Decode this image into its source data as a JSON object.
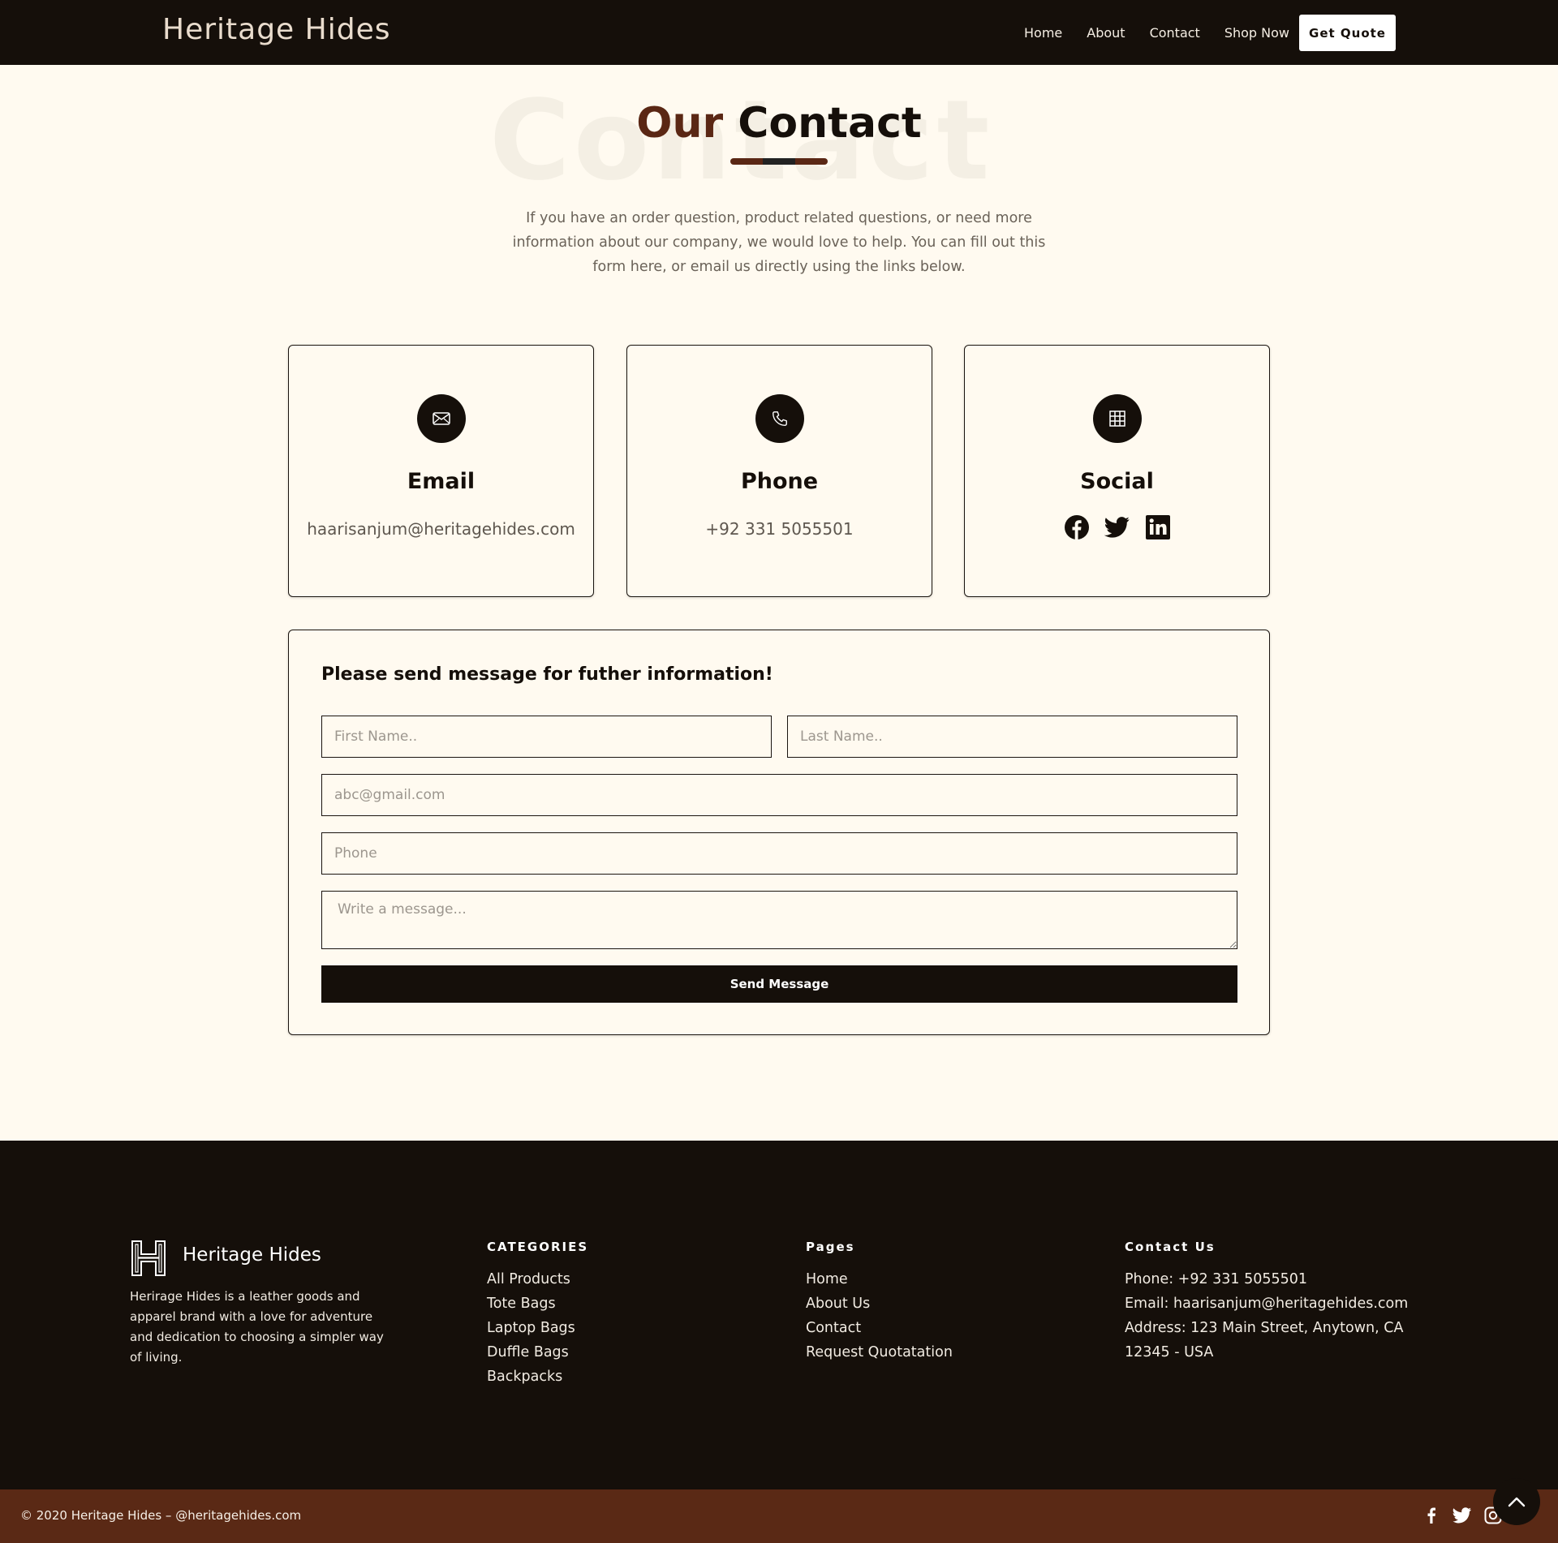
{
  "nav": {
    "brand": "Heritage Hides",
    "links": [
      "Home",
      "About",
      "Contact",
      "Shop Now"
    ],
    "quote_button": "Get Quote"
  },
  "hero": {
    "ghost_text": "Contact",
    "title_part1": "Our",
    "title_part2": "Contact",
    "intro": "If you have an order question, product related questions, or need more information about our company, we would love to help. You can fill out this form here, or email us directly using the links below."
  },
  "cards": {
    "email": {
      "icon": "envelope-icon",
      "title": "Email",
      "value": "haarisanjum@heritagehides.com"
    },
    "phone": {
      "icon": "phone-icon",
      "title": "Phone",
      "value": "+92 331 5055501"
    },
    "social": {
      "icon": "grid-icon",
      "title": "Social",
      "icons": [
        "facebook-icon",
        "twitter-icon",
        "linkedin-icon"
      ]
    }
  },
  "form": {
    "title": "Please send message for futher information!",
    "first_name_placeholder": "First Name..",
    "last_name_placeholder": "Last Name..",
    "email_placeholder": "abc@gmail.com",
    "phone_placeholder": "Phone",
    "message_placeholder": "Write a message...",
    "send_button": "Send Message"
  },
  "footer": {
    "brand": "Heritage Hides",
    "about": "Herirage Hides is a leather goods and apparel brand with a love for adventure and dedication to choosing a simpler way of living.",
    "categories": {
      "heading": "CATEGORIES",
      "items": [
        "All Products",
        "Tote Bags",
        "Laptop Bags",
        "Duffle Bags",
        "Backpacks"
      ]
    },
    "pages": {
      "heading": "Pages",
      "items": [
        "Home",
        "About Us",
        "Contact",
        "Request Quotatation"
      ]
    },
    "contact": {
      "heading": "Contact Us",
      "items": [
        "Phone: +92 331 5055501",
        "Email: haarisanjum@heritagehides.com",
        "Address: 123 Main Street, Anytown, CA",
        "12345 - USA"
      ]
    },
    "copyright": "© 2020 Heritage Hides – @heritagehides.com"
  },
  "colors": {
    "dark": "#150f0a",
    "brown": "#5a2714",
    "cream": "#fffaf0"
  }
}
